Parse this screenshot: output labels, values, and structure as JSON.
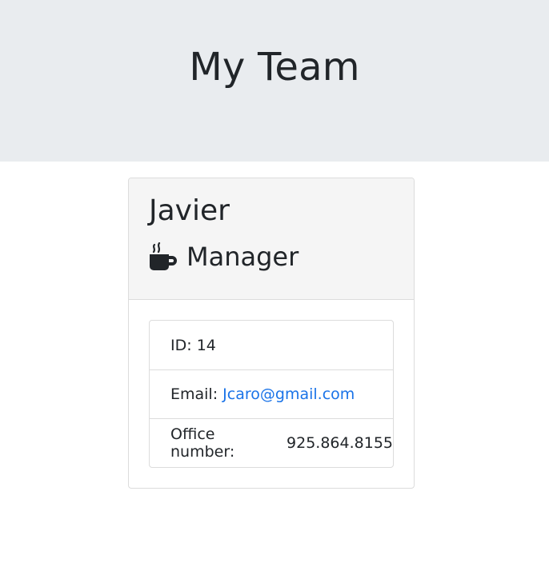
{
  "header": {
    "title": "My Team"
  },
  "employee": {
    "name": "Javier",
    "role": "Manager",
    "role_icon": "coffee-mug-icon",
    "details": {
      "id_label": "ID: ",
      "id_value": "14",
      "email_label": "Email: ",
      "email_value": "Jcaro@gmail.com",
      "office_label": "Office number: ",
      "office_value": "925.864.8155"
    }
  },
  "colors": {
    "jumbotron_bg": "#e9ecef",
    "card_header_bg": "#f5f5f5",
    "link": "#1a73e8"
  }
}
